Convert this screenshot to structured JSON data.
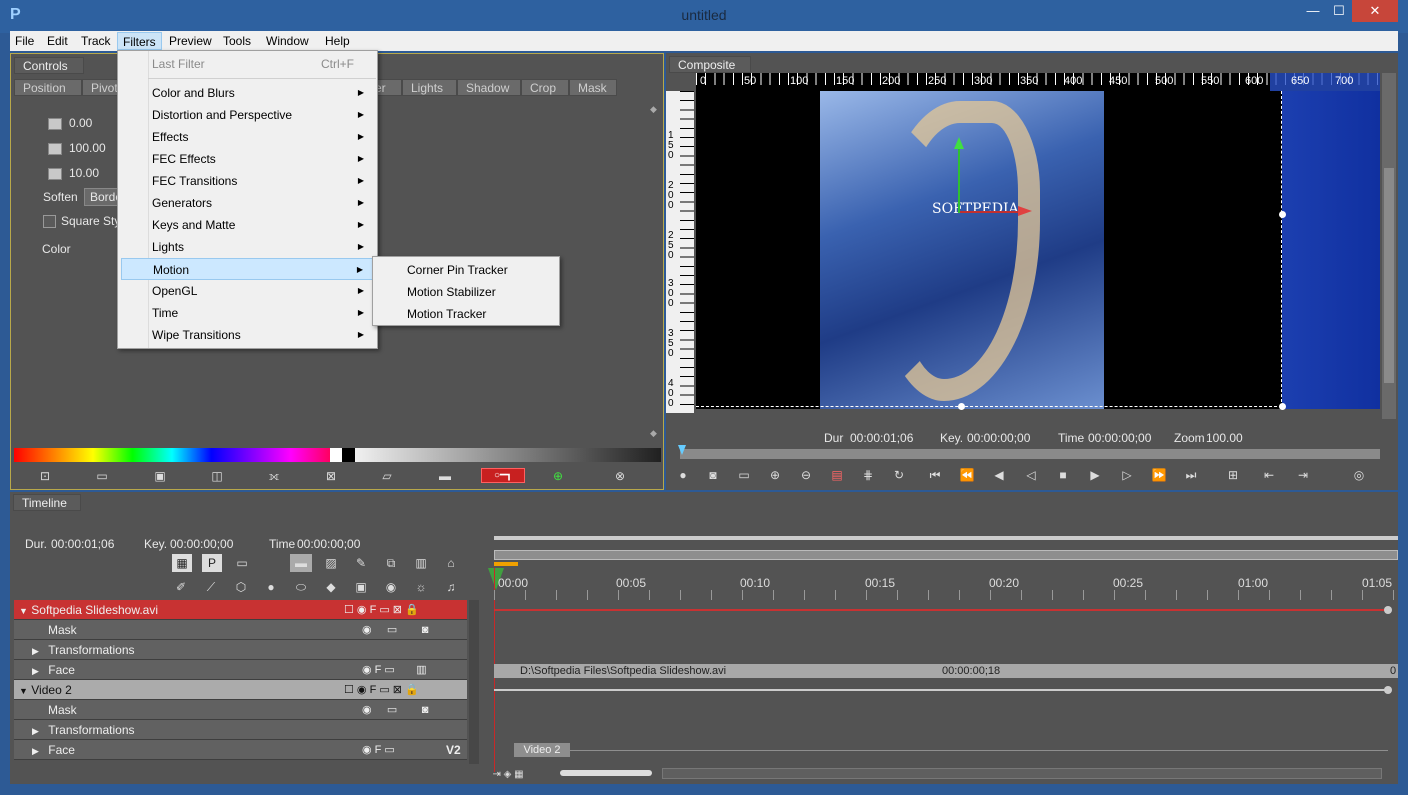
{
  "window": {
    "title": "untitled",
    "minimize": "—",
    "maximize": "☐",
    "close": "✕"
  },
  "menubar": [
    "File",
    "Edit",
    "Track",
    "Filters",
    "Preview",
    "Tools",
    "Window",
    "Help"
  ],
  "controls_panel": {
    "tab": "Controls",
    "subtabs": [
      "Position",
      "Pivot",
      "er",
      "Lights",
      "Shadow",
      "Crop",
      "Mask"
    ],
    "values": [
      "0.00",
      "100.00",
      "10.00"
    ],
    "soften_label": "Soften",
    "soften_value": "Borde",
    "square_style_label": "Square Style",
    "color_label": "Color"
  },
  "filters_menu": {
    "items": [
      {
        "label": "Last Filter",
        "shortcut": "Ctrl+F",
        "disabled": true
      },
      {
        "label": "Color and Blurs",
        "submenu": true
      },
      {
        "label": "Distortion and Perspective",
        "submenu": true
      },
      {
        "label": "Effects",
        "submenu": true
      },
      {
        "label": "FEC Effects",
        "submenu": true
      },
      {
        "label": "FEC Transitions",
        "submenu": true
      },
      {
        "label": "Generators",
        "submenu": true
      },
      {
        "label": "Keys and Matte",
        "submenu": true
      },
      {
        "label": "Lights",
        "submenu": true
      },
      {
        "label": "Motion",
        "submenu": true,
        "highlighted": true
      },
      {
        "label": "OpenGL",
        "submenu": true
      },
      {
        "label": "Time",
        "submenu": true
      },
      {
        "label": "Wipe Transitions",
        "submenu": true
      }
    ]
  },
  "motion_submenu": [
    "Corner Pin Tracker",
    "Motion Stabilizer",
    "Motion Tracker"
  ],
  "composite_panel": {
    "tab": "Composite",
    "ruler_h": [
      "0",
      "50",
      "100",
      "150",
      "200",
      "250",
      "300",
      "350",
      "400",
      "450",
      "500",
      "550",
      "600",
      "650",
      "700"
    ],
    "ruler_v": [
      "150",
      "200",
      "250",
      "300",
      "350",
      "400"
    ],
    "watermark": "SOFTPEDIA",
    "dur_label": "Dur",
    "dur_value": "00:00:01;06",
    "key_label": "Key.",
    "key_value": "00:00:00;00",
    "time_label": "Time",
    "time_value": "00:00:00;00",
    "zoom_label": "Zoom",
    "zoom_value": "100.00"
  },
  "timeline": {
    "tab": "Timeline",
    "dur_label": "Dur.",
    "dur_value": "00:00:01;06",
    "key_label": "Key.",
    "key_value": "00:00:00;00",
    "time_label": "Time",
    "time_value": "00:00:00;00",
    "ticks": [
      "00:00",
      "00:05",
      "00:10",
      "00:15",
      "00:20",
      "00:25",
      "01:00",
      "01:05"
    ],
    "tracks": [
      {
        "label": "Softpedia Slideshow.avi",
        "kind": "layer-red"
      },
      {
        "label": "Mask",
        "kind": "sub"
      },
      {
        "label": "Transformations",
        "kind": "sub-expand"
      },
      {
        "label": "Face",
        "kind": "sub-expand"
      },
      {
        "label": "Video 2",
        "kind": "layer-grey"
      },
      {
        "label": "Mask",
        "kind": "sub"
      },
      {
        "label": "Transformations",
        "kind": "sub-expand"
      },
      {
        "label": "Face",
        "kind": "sub-expand"
      }
    ],
    "clip_path": "D:\\Softpedia Files\\Softpedia Slideshow.avi",
    "clip_time": "00:00:00;18",
    "clip_end": "0",
    "video2_clip": "Video 2",
    "face_v2_badge": "V2"
  },
  "colors": {
    "accent": "#2e61a0",
    "track_red": "#c83232",
    "panel": "#535353",
    "playhead": "#c82828"
  }
}
